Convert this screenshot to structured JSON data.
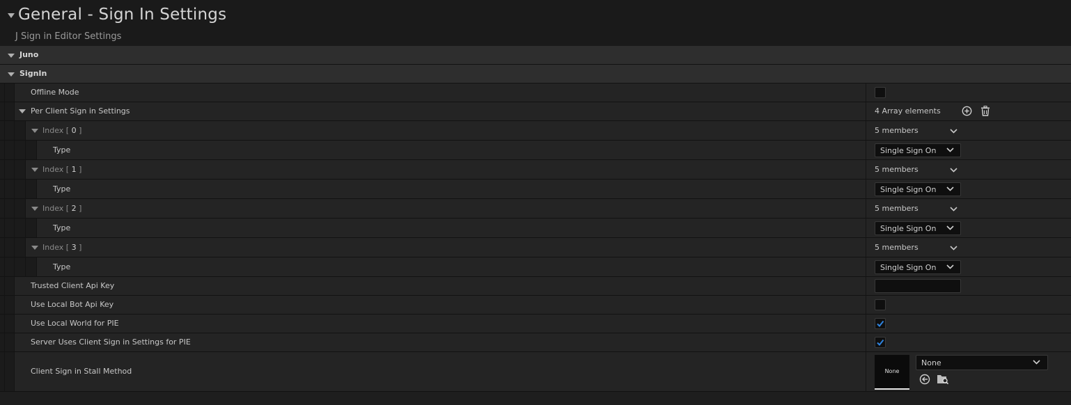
{
  "header": {
    "title": "General - Sign In Settings",
    "subtitle": "J Sign in Editor Settings"
  },
  "categories": {
    "juno": "Juno",
    "signin": "SignIn"
  },
  "properties": {
    "offline_mode": {
      "label": "Offline Mode",
      "checked": false
    },
    "per_client": {
      "label": "Per Client Sign in Settings",
      "value": "4 Array elements"
    },
    "elements": [
      {
        "prefix": "Index [ ",
        "index": "0",
        "suffix": " ]",
        "members": "5 members",
        "type_label": "Type",
        "type_value": "Single Sign On"
      },
      {
        "prefix": "Index [ ",
        "index": "1",
        "suffix": " ]",
        "members": "5 members",
        "type_label": "Type",
        "type_value": "Single Sign On"
      },
      {
        "prefix": "Index [ ",
        "index": "2",
        "suffix": " ]",
        "members": "5 members",
        "type_label": "Type",
        "type_value": "Single Sign On"
      },
      {
        "prefix": "Index [ ",
        "index": "3",
        "suffix": " ]",
        "members": "5 members",
        "type_label": "Type",
        "type_value": "Single Sign On"
      }
    ],
    "trusted_key": {
      "label": "Trusted Client Api Key",
      "value": ""
    },
    "local_bot": {
      "label": "Use Local Bot Api Key",
      "checked": false
    },
    "local_world": {
      "label": "Use Local World for PIE",
      "checked": true
    },
    "server_uses": {
      "label": "Server Uses Client Sign in Settings for PIE",
      "checked": true
    },
    "stall_method": {
      "label": "Client Sign in Stall Method",
      "thumb_text": "None",
      "value": "None"
    }
  },
  "icons": {
    "add": "plus-circle-icon",
    "delete": "trash-icon",
    "use_selected": "arrow-left-circle-icon",
    "browse": "folder-search-icon"
  },
  "colors": {
    "check": "#2f84e0",
    "background": "#151515",
    "row": "#242424",
    "category_row": "#2e2e2e"
  }
}
